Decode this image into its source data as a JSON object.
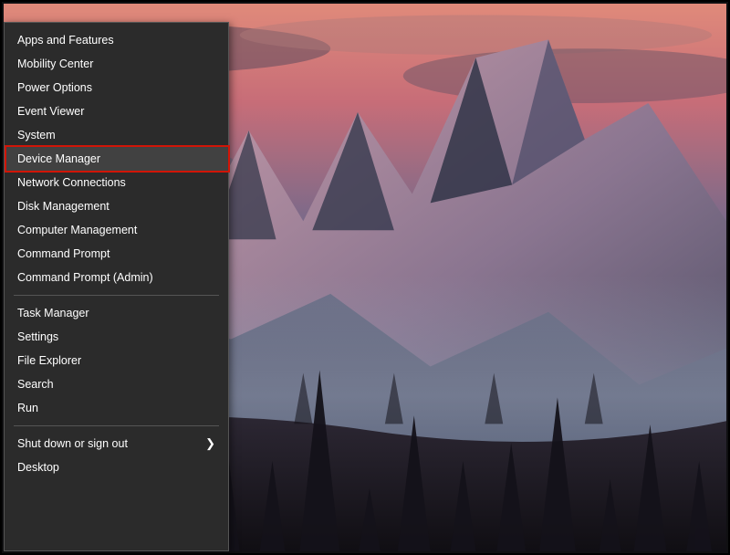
{
  "groups": [
    {
      "items": [
        {
          "id": "apps-and-features",
          "label": "Apps and Features"
        },
        {
          "id": "mobility-center",
          "label": "Mobility Center"
        },
        {
          "id": "power-options",
          "label": "Power Options"
        },
        {
          "id": "event-viewer",
          "label": "Event Viewer"
        },
        {
          "id": "system",
          "label": "System"
        },
        {
          "id": "device-manager",
          "label": "Device Manager",
          "highlighted": true,
          "red_box": true
        },
        {
          "id": "network-connections",
          "label": "Network Connections"
        },
        {
          "id": "disk-management",
          "label": "Disk Management"
        },
        {
          "id": "computer-management",
          "label": "Computer Management"
        },
        {
          "id": "command-prompt",
          "label": "Command Prompt"
        },
        {
          "id": "command-prompt-admin",
          "label": "Command Prompt (Admin)"
        }
      ]
    },
    {
      "items": [
        {
          "id": "task-manager",
          "label": "Task Manager"
        },
        {
          "id": "settings",
          "label": "Settings"
        },
        {
          "id": "file-explorer",
          "label": "File Explorer"
        },
        {
          "id": "search",
          "label": "Search"
        },
        {
          "id": "run",
          "label": "Run"
        }
      ]
    },
    {
      "items": [
        {
          "id": "shut-down-or-sign-out",
          "label": "Shut down or sign out",
          "submenu": true
        },
        {
          "id": "desktop",
          "label": "Desktop"
        }
      ]
    }
  ]
}
